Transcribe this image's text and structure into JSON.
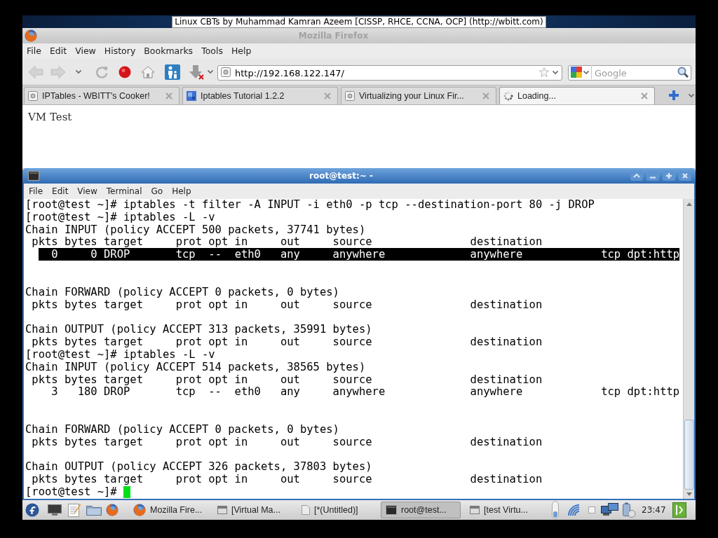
{
  "caption_banner": "Linux CBTs by Muhammad Kamran Azeem [CISSP, RHCE, CCNA, OCP] (http://wbitt.com)",
  "browser": {
    "window": {
      "title": "Mozilla Firefox"
    },
    "menu": [
      "File",
      "Edit",
      "View",
      "History",
      "Bookmarks",
      "Tools",
      "Help"
    ],
    "navigation": {
      "back": {
        "disabled": true
      },
      "forward": {
        "disabled": true
      }
    },
    "address": {
      "value": "http://192.168.122.147/"
    },
    "search": {
      "placeholder": "Google"
    },
    "tabs": [
      {
        "label": "IPTables - WBITT's Cooker!",
        "kind": "page",
        "selected": false
      },
      {
        "label": "Iptables Tutorial 1.2.2",
        "kind": "favicon",
        "selected": false
      },
      {
        "label": "Virtualizing your Linux Fir...",
        "kind": "page",
        "selected": false
      },
      {
        "label": "Loading...",
        "kind": "loading",
        "selected": true
      }
    ],
    "page": {
      "text": "VM Test"
    }
  },
  "terminal": {
    "window": {
      "title": "root@test:~ -"
    },
    "menu": [
      "File",
      "Edit",
      "View",
      "Terminal",
      "Go",
      "Help"
    ],
    "lines": [
      {
        "kind": "text",
        "text": "[root@test ~]# iptables -t filter -A INPUT -i eth0 -p tcp --destination-port 80 -j DROP",
        "highlighted": false
      },
      {
        "kind": "text",
        "text": "[root@test ~]# iptables -L -v",
        "highlighted": false
      },
      {
        "kind": "text",
        "text": "Chain INPUT (policy ACCEPT 500 packets, 37741 bytes)",
        "highlighted": false
      },
      {
        "kind": "text",
        "text": " pkts bytes target     prot opt in     out     source               destination",
        "highlighted": false
      },
      {
        "kind": "text",
        "text": "    0     0 DROP       tcp  --  eth0   any     anywhere             anywhere            tcp dpt:http",
        "highlighted": true
      },
      {
        "kind": "blank"
      },
      {
        "kind": "blank"
      },
      {
        "kind": "text",
        "text": "Chain FORWARD (policy ACCEPT 0 packets, 0 bytes)",
        "highlighted": false
      },
      {
        "kind": "text",
        "text": " pkts bytes target     prot opt in     out     source               destination",
        "highlighted": false
      },
      {
        "kind": "blank"
      },
      {
        "kind": "text",
        "text": "Chain OUTPUT (policy ACCEPT 313 packets, 35991 bytes)",
        "highlighted": false
      },
      {
        "kind": "text",
        "text": " pkts bytes target     prot opt in     out     source               destination",
        "highlighted": false
      },
      {
        "kind": "text",
        "text": "[root@test ~]# iptables -L -v",
        "highlighted": false
      },
      {
        "kind": "text",
        "text": "Chain INPUT (policy ACCEPT 514 packets, 38565 bytes)",
        "highlighted": false
      },
      {
        "kind": "text",
        "text": " pkts bytes target     prot opt in     out     source               destination",
        "highlighted": false
      },
      {
        "kind": "text",
        "text": "    3   180 DROP       tcp  --  eth0   any     anywhere             anywhere            tcp dpt:http",
        "highlighted": false
      },
      {
        "kind": "blank"
      },
      {
        "kind": "blank"
      },
      {
        "kind": "text",
        "text": "Chain FORWARD (policy ACCEPT 0 packets, 0 bytes)",
        "highlighted": false
      },
      {
        "kind": "text",
        "text": " pkts bytes target     prot opt in     out     source               destination",
        "highlighted": false
      },
      {
        "kind": "blank"
      },
      {
        "kind": "text",
        "text": "Chain OUTPUT (policy ACCEPT 326 packets, 37803 bytes)",
        "highlighted": false
      },
      {
        "kind": "text",
        "text": " pkts bytes target     prot opt in     out     source               destination",
        "highlighted": false
      },
      {
        "kind": "text",
        "text": "[root@test ~]#",
        "highlighted": false
      }
    ],
    "cursor": true
  },
  "taskbar": {
    "tasks": [
      {
        "label": "Mozilla Fire...",
        "kind": "browser",
        "selected": false
      },
      {
        "label": "[Virtual Ma...",
        "kind": "window",
        "selected": false
      },
      {
        "label": "[*(Untitled)]",
        "kind": "document",
        "selected": false
      },
      {
        "label": "root@test...",
        "kind": "terminal",
        "selected": true
      },
      {
        "label": "[test Virtu...",
        "kind": "window",
        "selected": false
      }
    ],
    "clock": "23:47"
  }
}
